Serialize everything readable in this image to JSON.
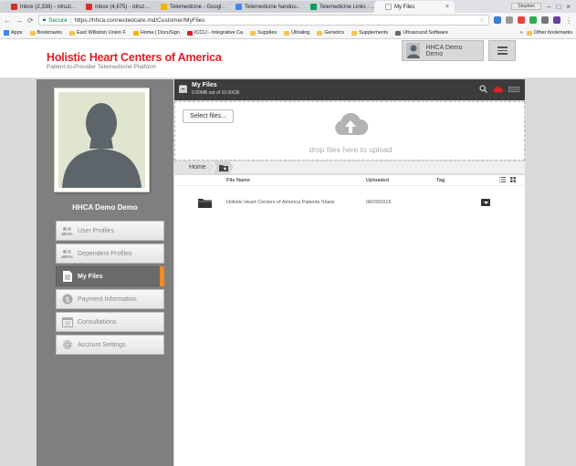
{
  "browser": {
    "tabs": [
      {
        "label": "Inbox (2,338) - rdruzi…",
        "icon_color": "#d93025"
      },
      {
        "label": "Inbox (4,675) - rdruz…",
        "icon_color": "#d93025"
      },
      {
        "label": "Telemedicine - Googl…",
        "icon_color": "#f4b400"
      },
      {
        "label": "Telemedicine handou…",
        "icon_color": "#4285f4"
      },
      {
        "label": "Telemedicine Links - …",
        "icon_color": "#0f9d58"
      },
      {
        "label": "My Files",
        "icon_color": "#ffffff"
      }
    ],
    "user_chip": "Stephen",
    "secure_label": "Secure",
    "url": "https://hhca.connectedcare.md/Customer/MyFiles",
    "bookmarks": [
      "Apps",
      "Bookmarks",
      "East Williston Union F",
      "Home | DocuSign",
      "ICCLI - Integrative Ca",
      "Supplies",
      "Ultraling",
      "Genetics",
      "Supplements",
      "Ultrasound Software"
    ],
    "overflow_label": "»",
    "other_bookmarks": "Other bookmarks"
  },
  "header": {
    "brand_title": "Holistic Heart Centers of America",
    "brand_subtitle": "Patient-to-Provider Telemedicine Platform",
    "user_name": "HHCA Demo Demo"
  },
  "sidebar": {
    "name": "HHCA Demo Demo",
    "items": [
      {
        "label": "User Profiles",
        "icon": "users-icon"
      },
      {
        "label": "Dependent Profiles",
        "icon": "users-icon"
      },
      {
        "label": "My Files",
        "icon": "file-icon",
        "active": true
      },
      {
        "label": "Payment Information",
        "icon": "dollar-icon"
      },
      {
        "label": "Consultations",
        "icon": "calendar-icon"
      },
      {
        "label": "Account Settings",
        "icon": "gear-icon"
      }
    ]
  },
  "files_panel": {
    "title": "My Files",
    "usage": "0.00MB out of 10.00GB",
    "select_button": "Select files...",
    "drop_text": "drop files here to upload",
    "breadcrumb_home": "Home",
    "columns": {
      "name": "File Name",
      "uploaded": "Uploaded",
      "tag": "Tag"
    },
    "rows": [
      {
        "name": "Holistic Heart Centers of America Patients Share",
        "uploaded": "08/09/2016",
        "tag": "",
        "type": "folder"
      }
    ]
  },
  "colors": {
    "brand_red": "#e01e25",
    "active_accent": "#f28a1e",
    "panel_dark": "#3c3c3c",
    "sidebar_gray": "#7f7f7f"
  }
}
